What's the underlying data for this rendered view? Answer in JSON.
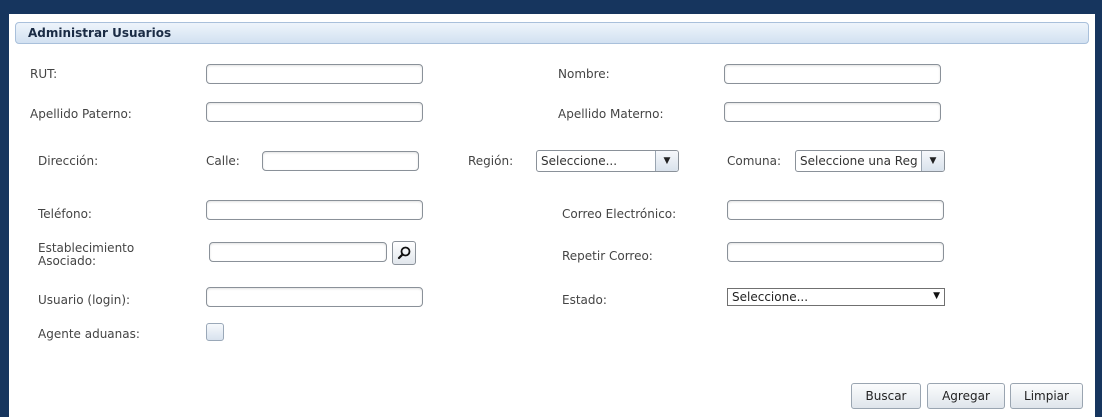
{
  "panel": {
    "title": "Administrar Usuarios"
  },
  "labels": {
    "rut": "RUT:",
    "nombre": "Nombre:",
    "apellido_paterno": "Apellido Paterno:",
    "apellido_materno": "Apellido Materno:",
    "direccion": "Dirección:",
    "calle": "Calle:",
    "region": "Región:",
    "comuna": "Comuna:",
    "telefono": "Teléfono:",
    "correo": "Correo Electrónico:",
    "establecimiento_line1": "Establecimiento",
    "establecimiento_line2": "Asociado:",
    "repetir_correo": "Repetir Correo:",
    "usuario": "Usuario (login):",
    "estado": "Estado:",
    "agente": "Agente aduanas:"
  },
  "fields": {
    "rut": "",
    "nombre": "",
    "apellido_paterno": "",
    "apellido_materno": "",
    "calle": "",
    "telefono": "",
    "correo": "",
    "establecimiento": "",
    "repetir_correo": "",
    "usuario": ""
  },
  "selects": {
    "region": "Seleccione...",
    "comuna": "Seleccione una Reg",
    "estado": "Seleccione..."
  },
  "checkbox": {
    "agente_aduanas_checked": false
  },
  "buttons": {
    "buscar": "Buscar",
    "agregar": "Agregar",
    "limpiar": "Limpiar"
  },
  "icons": {
    "dropdown": "chevron-down-icon",
    "search": "magnifier-icon"
  },
  "colors": {
    "frame": "#16355e",
    "header_start": "#eef4fb",
    "header_end": "#d2e1f1"
  }
}
